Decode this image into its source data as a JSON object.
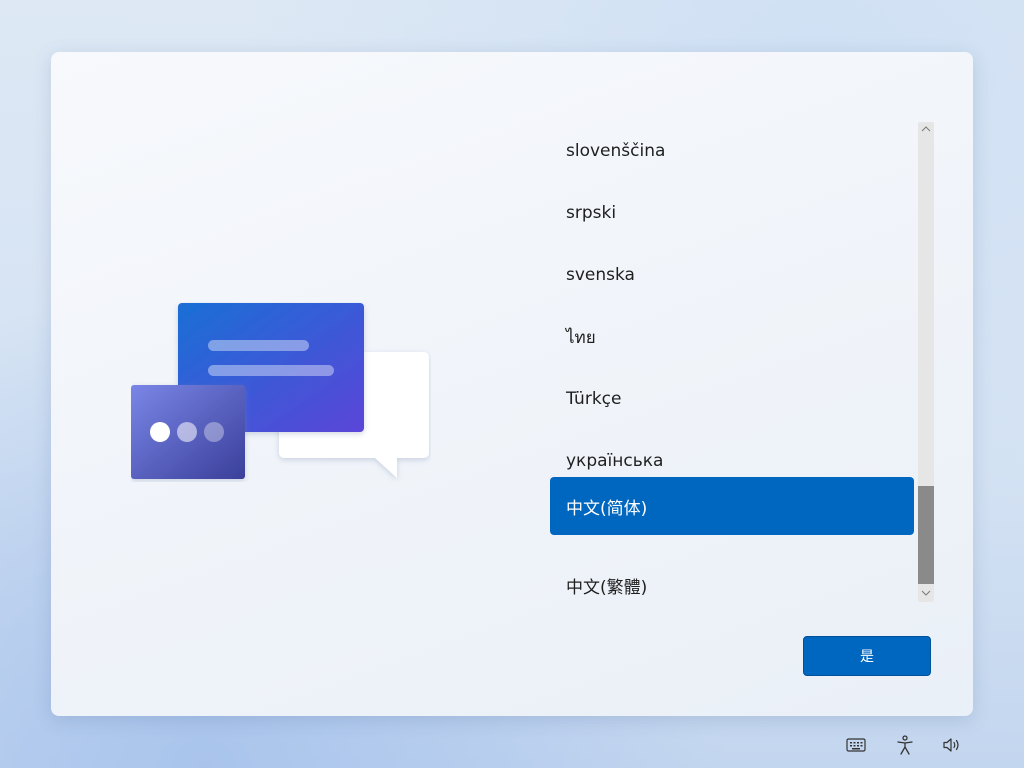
{
  "languages": [
    {
      "label": "slovenščina",
      "selected": false
    },
    {
      "label": "srpski",
      "selected": false
    },
    {
      "label": "svenska",
      "selected": false
    },
    {
      "label": "ไทย",
      "selected": false
    },
    {
      "label": "Türkçe",
      "selected": false
    },
    {
      "label": "українська",
      "selected": false
    },
    {
      "label": "中文(简体)",
      "selected": true
    },
    {
      "label": "中文(繁體)",
      "selected": false
    }
  ],
  "buttons": {
    "yes_label": "是"
  },
  "colors": {
    "accent": "#0067c0"
  },
  "tray_icons": [
    "keyboard-icon",
    "accessibility-icon",
    "volume-icon"
  ]
}
